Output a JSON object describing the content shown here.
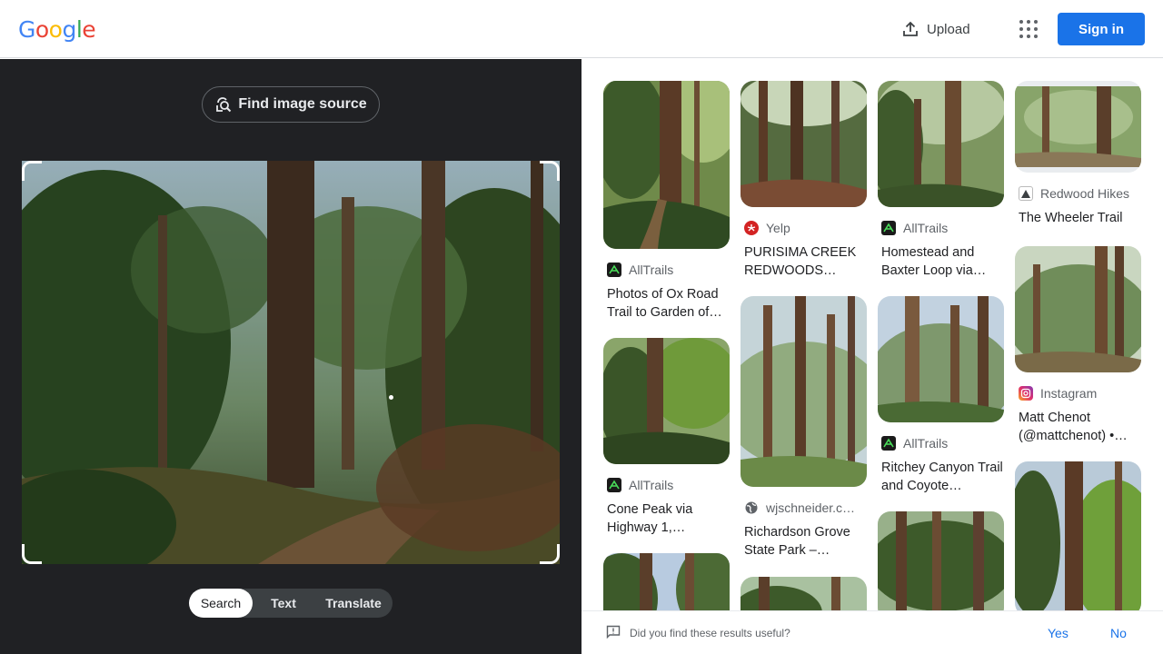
{
  "header": {
    "logo": "Google",
    "upload_label": "Upload",
    "signin_label": "Sign in"
  },
  "left_panel": {
    "find_source_label": "Find image source",
    "tabs": [
      {
        "label": "Search",
        "active": true
      },
      {
        "label": "Text",
        "active": false
      },
      {
        "label": "Translate",
        "active": false
      }
    ]
  },
  "results": [
    {
      "source": "AllTrails",
      "title": "Photos of Ox Road Trail to Garden of…",
      "icon": "alltrails-icon"
    },
    {
      "source": "AllTrails",
      "title": "Cone Peak via Highway 1,…",
      "icon": "alltrails-icon"
    },
    {
      "source": "Yelp",
      "title": "PURISIMA CREEK REDWOODS…",
      "icon": "yelp-icon"
    },
    {
      "source": "wjschneider.c…",
      "title": "Richardson Grove State Park –…",
      "icon": "globe-icon"
    },
    {
      "source": "AllTrails",
      "title": "Homestead and Baxter Loop via…",
      "icon": "alltrails-icon"
    },
    {
      "source": "AllTrails",
      "title": "Ritchey Canyon Trail and Coyote…",
      "icon": "alltrails-icon"
    },
    {
      "source": "Redwood Hikes",
      "title": "The Wheeler Trail",
      "icon": "redwood-hikes-icon"
    },
    {
      "source": "Instagram",
      "title": "Matt Chenot (@mattchenot) •…",
      "icon": "instagram-icon"
    }
  ],
  "feedback": {
    "question": "Did you find these results useful?",
    "yes": "Yes",
    "no": "No"
  },
  "colors": {
    "accent": "#1a73e8",
    "panel_dark": "#202124",
    "alltrails_green": "#1a1a1a",
    "yelp_red": "#d32323"
  }
}
